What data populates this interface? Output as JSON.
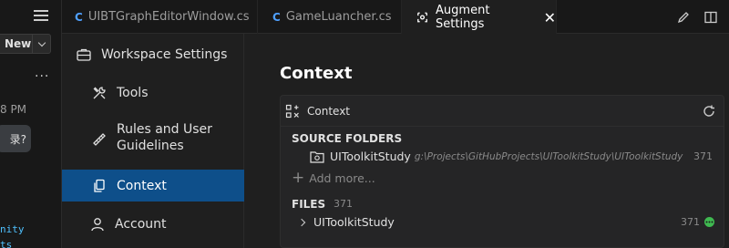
{
  "left_panel": {
    "new_label": "New",
    "more_label": "...",
    "time": "8 PM",
    "bubble_text": "录?",
    "code_lines": [
      "nity",
      "ts"
    ]
  },
  "tabs": [
    {
      "label": "UIBTGraphEditorWindow.cs",
      "icon": "C"
    },
    {
      "label": "GameLuancher.cs",
      "icon": "C"
    },
    {
      "label": "Augment Settings",
      "close": "✕"
    }
  ],
  "nav": {
    "workspace_settings": "Workspace Settings",
    "tools": "Tools",
    "rules": "Rules and User",
    "rules_line2": "Guidelines",
    "context": "Context",
    "account": "Account"
  },
  "main": {
    "title": "Context",
    "card_title": "Context",
    "source_folders_heading": "SOURCE FOLDERS",
    "folder": {
      "name": "UIToolkitStudy",
      "path": "g:\\Projects\\GitHubProjects\\UIToolkitStudy\\UIToolkitStudy",
      "count": "371"
    },
    "add_more": "Add more...",
    "files_heading": "FILES",
    "files_count": "371",
    "file": {
      "name": "UIToolkitStudy",
      "count": "371"
    }
  },
  "colors": {
    "accent": "#0e4f8a",
    "status_green": "#3fb950",
    "cs_icon": "#4fa0ff"
  }
}
